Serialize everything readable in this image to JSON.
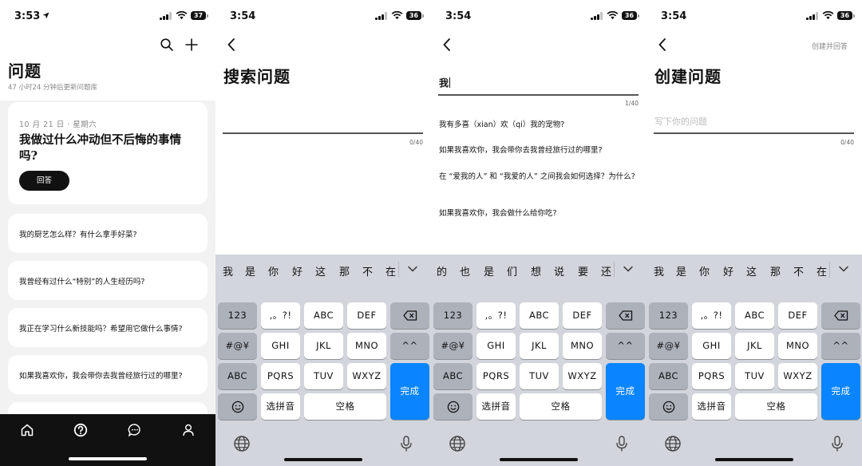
{
  "screens": [
    {
      "status": {
        "time": "3:53",
        "battery": "37"
      },
      "title": "问题",
      "subtitle": "47 小时24 分钟后更新问题库",
      "featured": {
        "date": "10 月 21 日 · 星期六",
        "question": "我做过什么冲动但不后悔的事情吗?",
        "answer_label": "回答"
      },
      "questions": [
        "我的厨艺怎么样？有什么拿手好菜?",
        "我曾经有过什么“特别”的人生经历吗?",
        "我正在学习什么新技能吗？希望用它做什么事情?",
        "如果我喜欢你，我会带你去我曾经旅行过的哪里?"
      ],
      "icons": {
        "search": "search-icon",
        "add": "plus-icon",
        "tabs": [
          "home-icon",
          "question-icon",
          "chat-icon",
          "profile-icon"
        ]
      }
    },
    {
      "status": {
        "time": "3:54",
        "battery": "36"
      },
      "title": "搜索问题",
      "counter": "0/40"
    },
    {
      "status": {
        "time": "3:54",
        "battery": "36"
      },
      "typed": "我",
      "counter": "1/40",
      "suggestions": [
        "我有多喜（xian）欢（qi）我的宠物?",
        "如果我喜欢你，我会带你去我曾经旅行过的哪里?",
        "在 “爱我的人” 和 “我爱的人” 之间我会如何选择？为什么?",
        "如果我喜欢你，我会做什么给你吃?"
      ]
    },
    {
      "status": {
        "time": "3:54",
        "battery": "36"
      },
      "title": "创建问题",
      "action": "创建并回答",
      "placeholder": "写下你的问题",
      "counter": "0/40"
    }
  ],
  "keyboard": {
    "candidates_default": [
      "我",
      "是",
      "你",
      "好",
      "这",
      "那",
      "不",
      "在"
    ],
    "candidates_after_wo": [
      "的",
      "也",
      "是",
      "们",
      "想",
      "说",
      "要",
      "还"
    ],
    "rows": {
      "num": "123",
      "punct": ",。?!",
      "abc": "ABC",
      "def": "DEF",
      "sym": "#@¥",
      "ghi": "GHI",
      "jkl": "JKL",
      "mno": "MNO",
      "emoticon": "^^",
      "abc_mode": "ABC",
      "pqrs": "PQRS",
      "tuv": "TUV",
      "wxyz": "WXYZ",
      "done": "完成",
      "pinyin": "选拼音",
      "space": "空格"
    }
  }
}
